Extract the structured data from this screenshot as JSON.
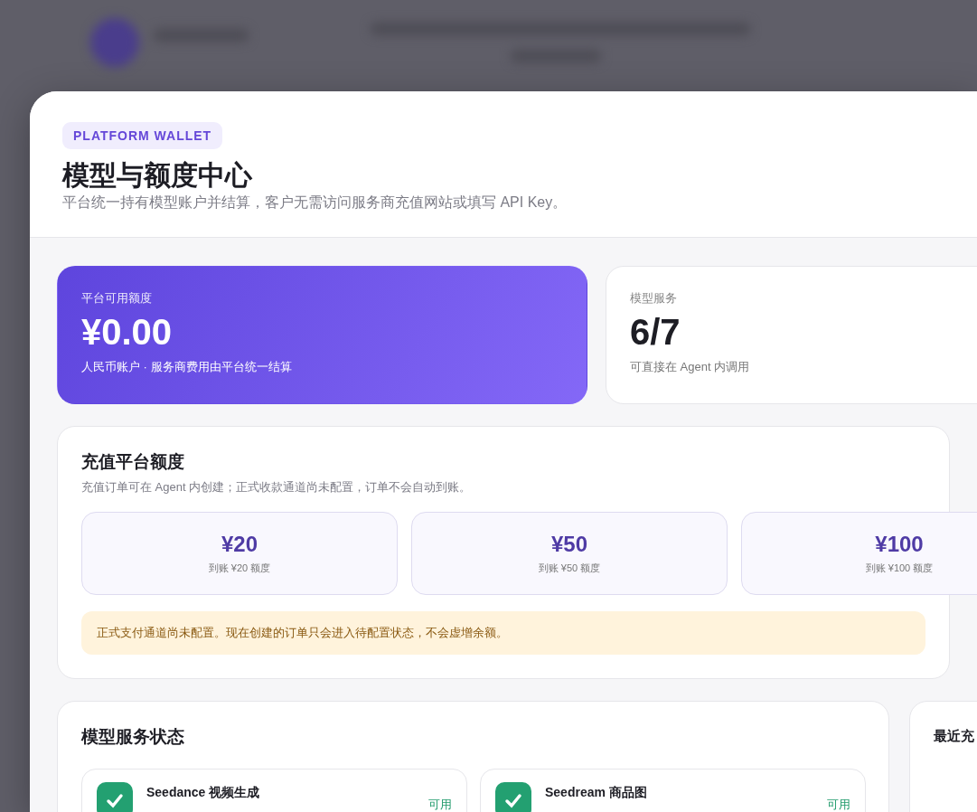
{
  "badge": "PLATFORM WALLET",
  "title": "模型与额度中心",
  "subtitle": "平台统一持有模型账户并结算，客户无需访问服务商充值网站或填写 API Key。",
  "stats": [
    {
      "kind": "primary",
      "label": "平台可用额度",
      "value": "¥0.00",
      "note": "人民币账户 · 服务商费用由平台统一结算"
    },
    {
      "kind": "plain",
      "label": "模型服务",
      "value": "6/7",
      "note": "可直接在 Agent 内调用"
    }
  ],
  "recharge": {
    "title": "充值平台额度",
    "subtitle": "充值订单可在 Agent 内创建；正式收款通道尚未配置，订单不会自动到账。",
    "options": [
      {
        "amount": "¥20",
        "note": "到账 ¥20 额度"
      },
      {
        "amount": "¥50",
        "note": "到账 ¥50 额度"
      },
      {
        "amount": "¥100",
        "note": "到账 ¥100 额度"
      }
    ],
    "notice": "正式支付通道尚未配置。现在创建的订单只会进入待配置状态，不会虚增余额。"
  },
  "services": {
    "title": "模型服务状态",
    "items": [
      {
        "name": "Seedance 视频生成",
        "status": "可用"
      },
      {
        "name": "Seedream 商品图",
        "status": "可用"
      }
    ]
  },
  "recent": {
    "title": "最近充"
  }
}
